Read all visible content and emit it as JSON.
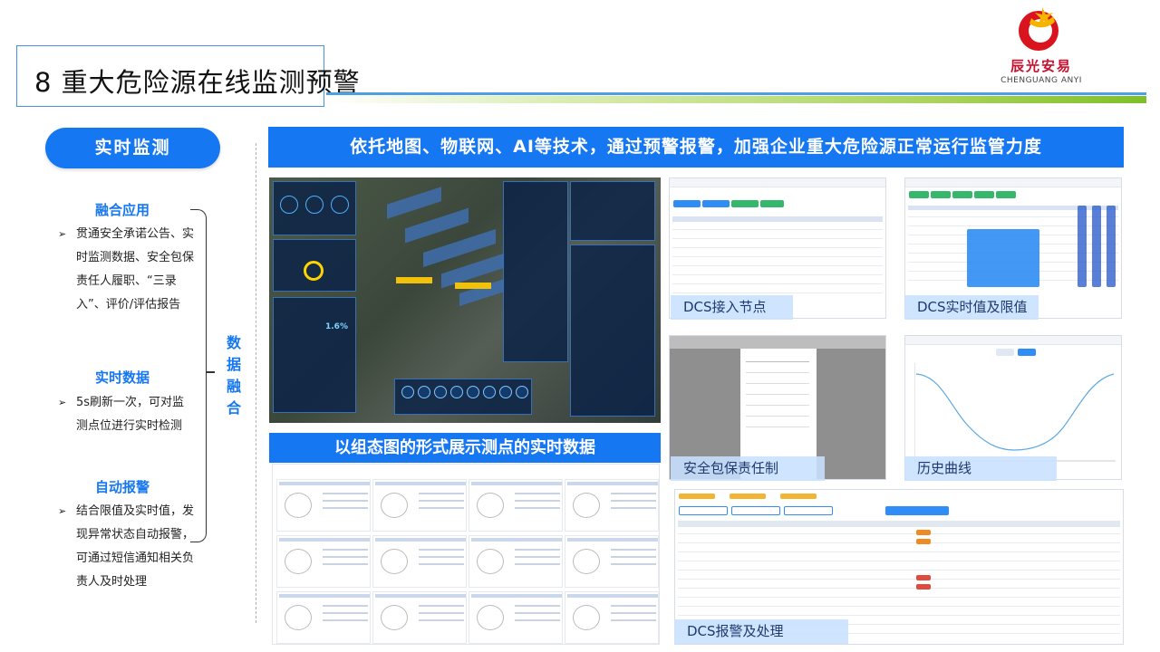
{
  "header": {
    "title": "8 重大危险源在线监测预警",
    "logo": {
      "name_cn": "辰光安易",
      "name_en": "CHENGUANG ANYI"
    }
  },
  "left": {
    "pill_label": "实时监测",
    "fusion_label": "数据融合",
    "sections": [
      {
        "heading": "融合应用",
        "text": "贯通安全承诺公告、实时监测数据、安全包保责任人履职、“三录入”、评价/评估报告"
      },
      {
        "heading": "实时数据",
        "text": "5s刷新一次，可对监测点位进行实时检测"
      },
      {
        "heading": "自动报警",
        "text": "结合限值及实时值，发现异常状态自动报警，可通过短信通知相关负责人及时处理"
      }
    ]
  },
  "banners": {
    "top": "依托地图、物联网、AI等技术，通过预警报警，加强企业重大危险源正常运行监管力度",
    "middle": "以组态图的形式展示测点的实时数据"
  },
  "map_panel": {
    "percent": "1.6%"
  },
  "screenshots": [
    {
      "caption": "DCS接入节点"
    },
    {
      "caption": "DCS实时值及限值"
    },
    {
      "caption": "安全包保责任制"
    },
    {
      "caption": "历史曲线"
    },
    {
      "caption": "DCS报警及处理"
    }
  ],
  "colors": {
    "accent": "#1677f2",
    "logo_red": "#c8102e",
    "rule_green": "#7fbf2a"
  }
}
